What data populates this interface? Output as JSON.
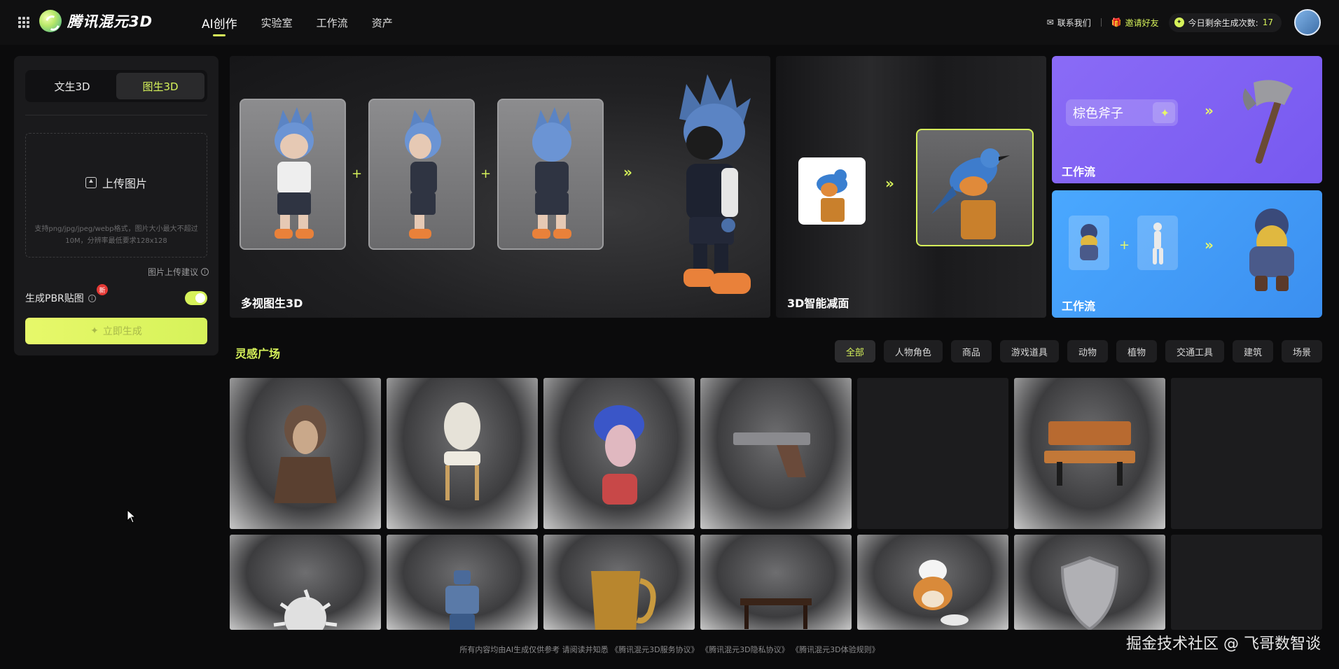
{
  "app": {
    "logo_text": "腾讯混元3D"
  },
  "nav": {
    "items": [
      {
        "label": "AI创作",
        "active": true
      },
      {
        "label": "实验室"
      },
      {
        "label": "工作流"
      },
      {
        "label": "资产"
      }
    ]
  },
  "header": {
    "contact": "联系我们",
    "invite": "邀请好友",
    "quota_label": "今日剩余生成次数:",
    "quota_value": "17"
  },
  "sidebar": {
    "tabs": [
      {
        "label": "文生3D"
      },
      {
        "label": "图生3D",
        "active": true
      }
    ],
    "upload_label": "上传图片",
    "upload_hint": "支持png/jpg/jpeg/webp格式，图片大小最大不超过10M，分辨率最低要求128x128",
    "upload_advice": "图片上传建议",
    "pbr_label": "生成PBR贴图",
    "pbr_new_badge": "新",
    "pbr_enabled": true,
    "generate_button": "立即生成"
  },
  "banners": {
    "multi_view": {
      "title": "多视图生3D"
    },
    "reduce": {
      "title": "3D智能减面"
    },
    "workflow1": {
      "title": "工作流",
      "input_text": "棕色斧子"
    },
    "workflow2": {
      "title": "工作流"
    }
  },
  "gallery": {
    "title": "灵感广场",
    "filters": [
      {
        "label": "全部",
        "active": true
      },
      {
        "label": "人物角色"
      },
      {
        "label": "商品"
      },
      {
        "label": "游戏道具"
      },
      {
        "label": "动物"
      },
      {
        "label": "植物"
      },
      {
        "label": "交通工具"
      },
      {
        "label": "建筑"
      },
      {
        "label": "场景"
      }
    ]
  },
  "footer": {
    "text": "所有内容均由AI生成仅供参考 请阅读并知悉 《腾讯混元3D服务协议》 《腾讯混元3D隐私协议》 《腾讯混元3D体验规则》"
  },
  "watermark": "掘金技术社区 @ 飞哥数智谈",
  "colors": {
    "accent": "#d6f25a",
    "workflow_purple": "#7f62f4",
    "workflow_blue": "#4499f8"
  }
}
